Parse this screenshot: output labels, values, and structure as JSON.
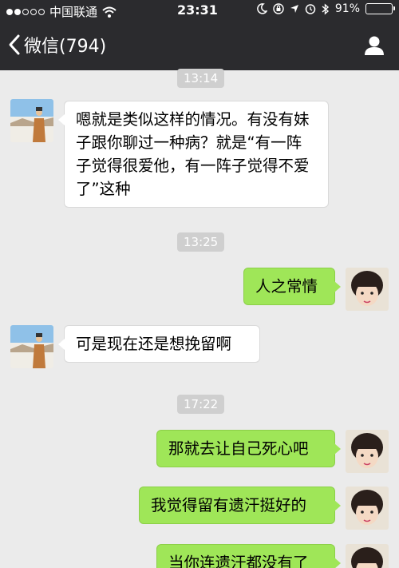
{
  "status_bar": {
    "carrier": "中国联通",
    "time": "23:31",
    "battery_percent": "91%",
    "battery_level": 0.91,
    "signal_dots_filled": 2,
    "signal_dots_total": 5
  },
  "nav": {
    "back_label": "微信(794)",
    "back_icon": "chevron-left-icon",
    "profile_icon": "person-icon"
  },
  "colors": {
    "bar_bg": "#2b2b2e",
    "chat_bg": "#ebebeb",
    "sent_bubble": "#9fe658",
    "received_bubble": "#ffffff"
  },
  "chat": {
    "timestamp_1": "13:14",
    "message_1": "嗯就是类似这样的情况。有没有妹子跟你聊过一种病？就是“有一阵子觉得很爱他，有一阵子觉得不爱了”这种",
    "timestamp_2": "13:25",
    "message_2": "人之常情",
    "message_3": "可是现在还是想挽留啊",
    "timestamp_3": "17:22",
    "message_4": "那就去让自己死心吧",
    "message_5": "我觉得留有遗汗挺好的",
    "message_6": "当你连遗汗都没有了"
  }
}
